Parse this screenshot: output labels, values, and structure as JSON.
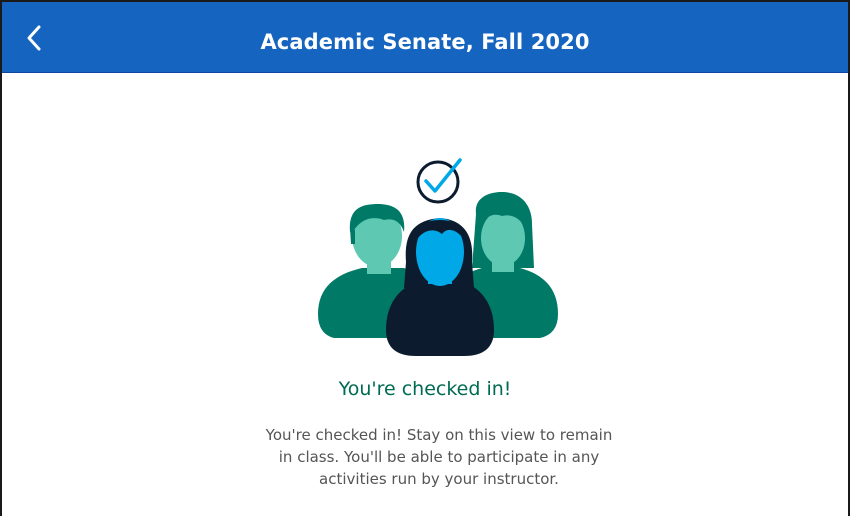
{
  "header": {
    "title": "Academic Senate, Fall 2020",
    "background_color": "#1565c0",
    "back_icon": "chevron-left-icon"
  },
  "illustration": {
    "icons": [
      "check-circle-icon",
      "people-group-icon"
    ],
    "colors": {
      "person_dark_green": "#007a66",
      "person_light_green": "#5ec8b3",
      "center_dark": "#0d1b2e",
      "center_face": "#00a8e8",
      "check": "#00a8e8"
    }
  },
  "status": {
    "heading": "You're checked in!",
    "heading_color": "#006b53",
    "message": "You're checked in! Stay on this view to remain in class. You'll be able to participate in any activities run by your instructor."
  }
}
